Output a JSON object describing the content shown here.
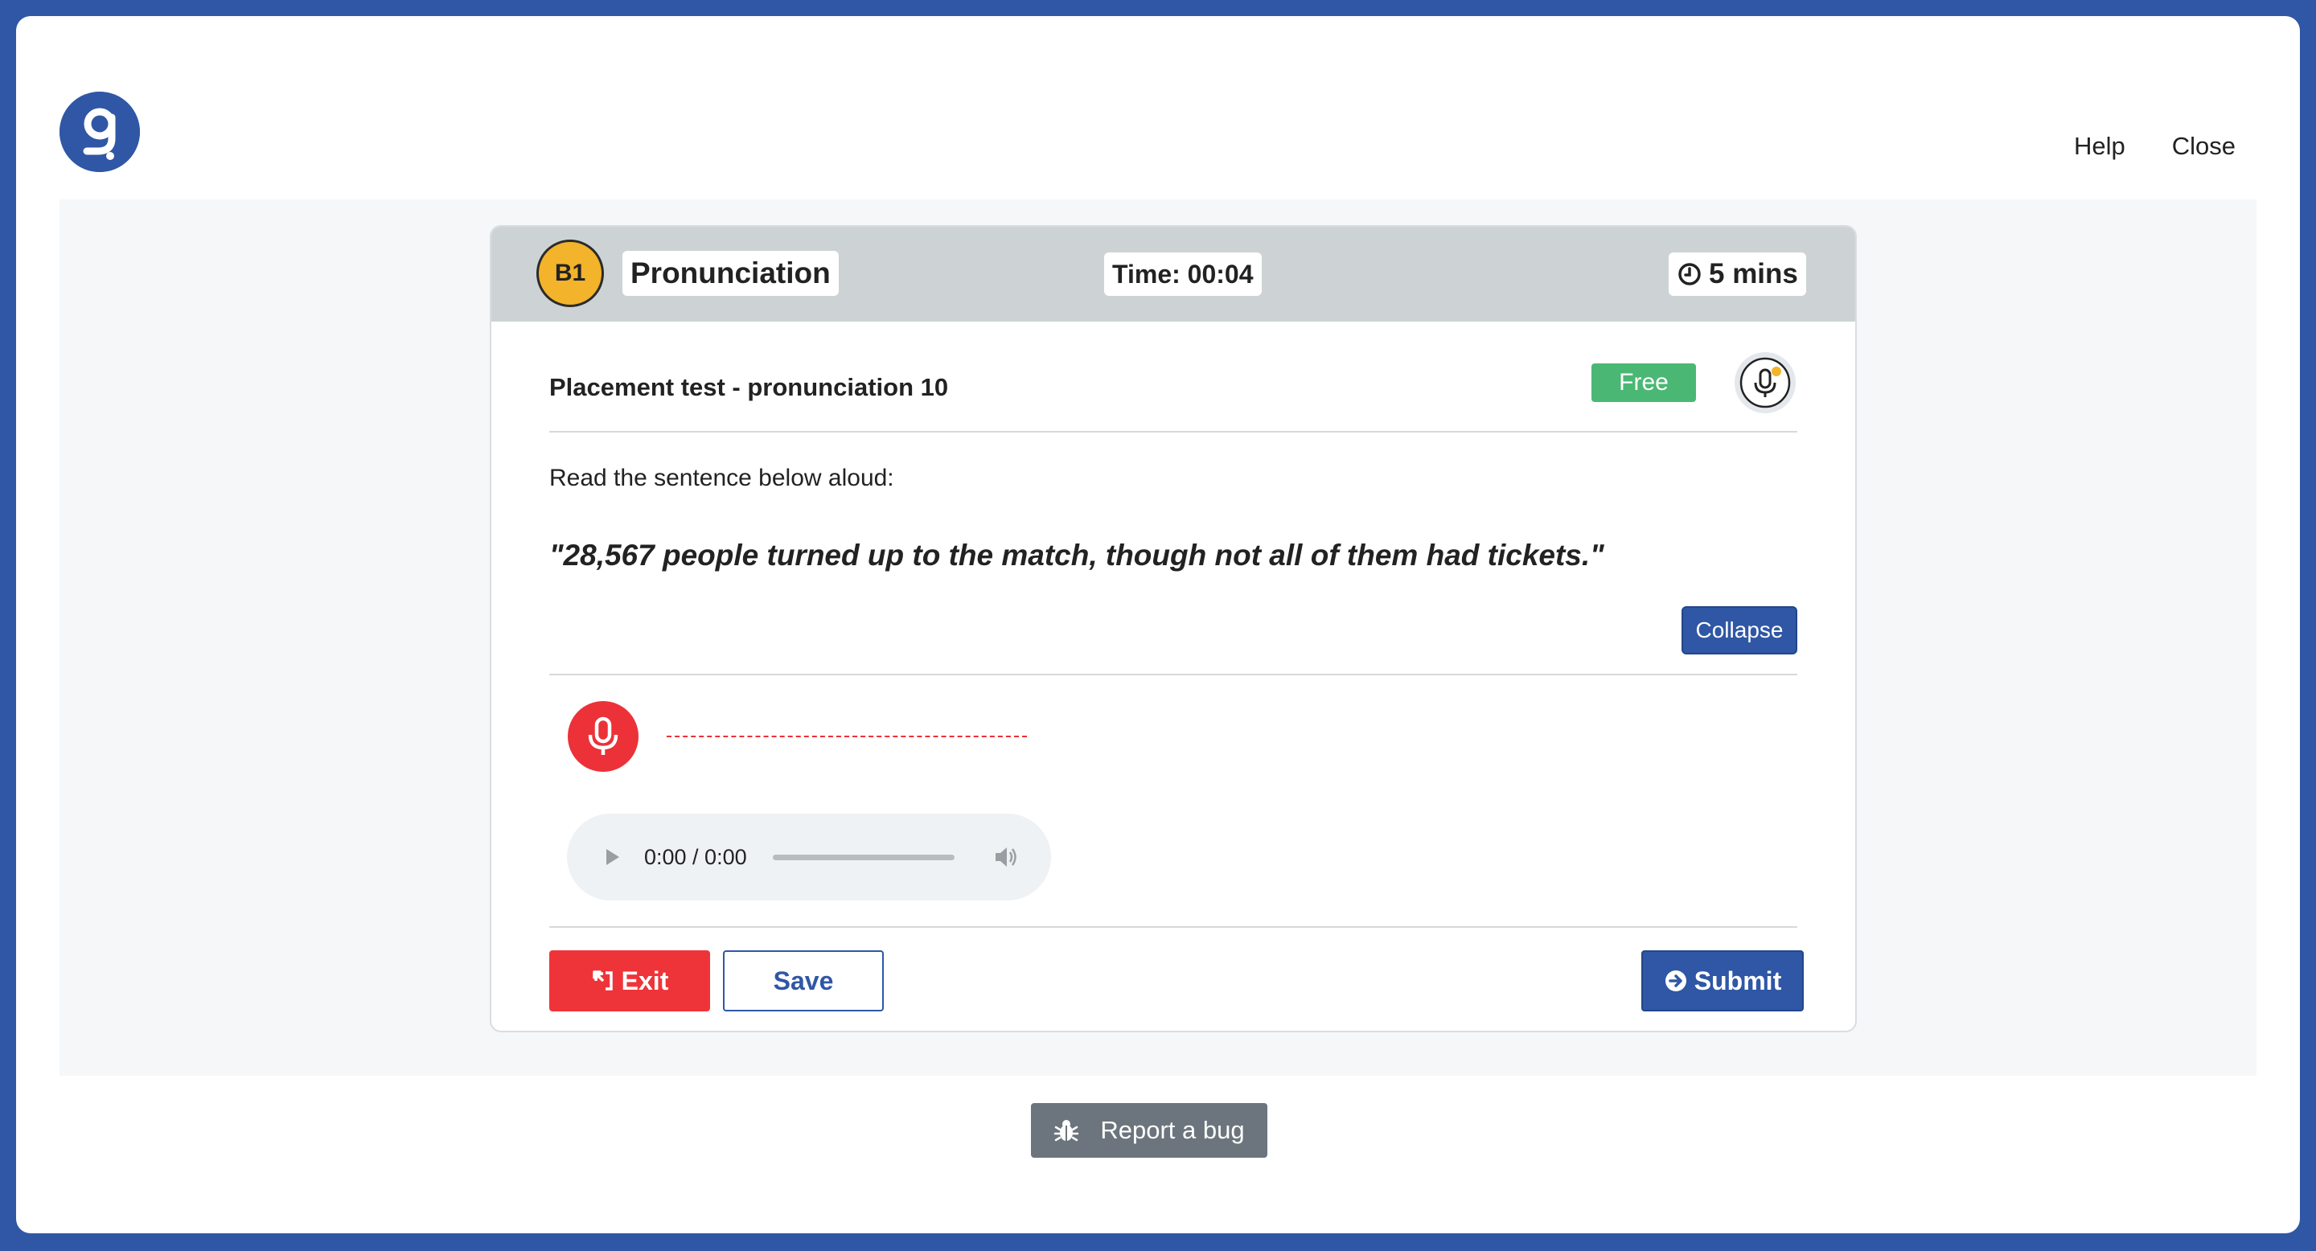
{
  "nav": {
    "help_label": "Help",
    "close_label": "Close"
  },
  "card": {
    "level": "B1",
    "skill": "Pronunciation",
    "timer": "Time: 00:04",
    "duration": "5 mins",
    "test_title": "Placement test - pronunciation 10",
    "badge": "Free",
    "instruction": "Read the sentence below aloud:",
    "sentence": "\"28,567 people turned up to the match, though not all of them had tickets.\"",
    "collapse_label": "Collapse",
    "audio": {
      "time": "0:00 / 0:00",
      "progress": 0
    },
    "actions": {
      "exit_label": "Exit",
      "save_label": "Save",
      "submit_label": "Submit"
    }
  },
  "footer": {
    "report_label": "Report a bug"
  },
  "colors": {
    "brand": "#2f57a5",
    "danger": "#ef3439",
    "success": "#4ab874",
    "level_badge": "#f3b32a",
    "secondary": "#6c757d"
  },
  "icons": {
    "logo": "brand-logo-icon",
    "clock": "clock-icon",
    "mic": "microphone-icon",
    "record": "record-microphone-icon",
    "play": "play-icon",
    "volume": "volume-icon",
    "exit": "exit-icon",
    "submit": "arrow-right-circle-icon",
    "bug": "bug-icon"
  }
}
